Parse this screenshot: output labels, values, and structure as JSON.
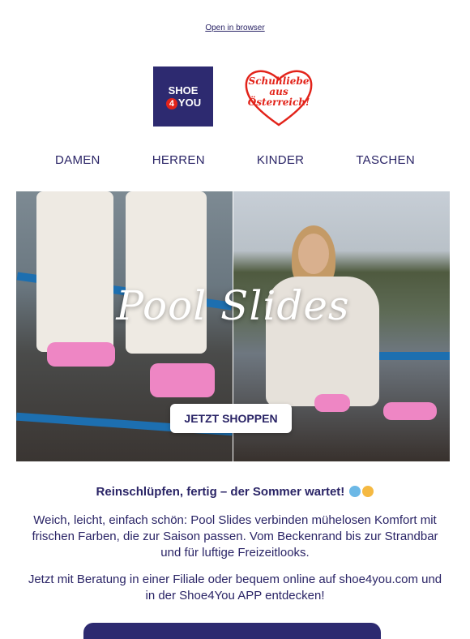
{
  "header": {
    "browser_link": "Open in browser"
  },
  "logo": {
    "line1": "SHOE",
    "four": "4",
    "line2": "YOU"
  },
  "badge": {
    "line1": "Schuhliebe",
    "line2": "aus",
    "line3": "Österreich!"
  },
  "nav": {
    "items": [
      "DAMEN",
      "HERREN",
      "KINDER",
      "TASCHEN"
    ]
  },
  "hero": {
    "headline": "Pool Slides",
    "cta": "JETZT SHOPPEN"
  },
  "content": {
    "tagline": "Reinschlüpfen, fertig – der Sommer wartet!",
    "paragraph1": "Weich, leicht, einfach schön: Pool Slides verbinden mühelosen Komfort mit frischen Farben, die zur Saison passen. Vom Beckenrand bis zur Strandbar und für luftige Freizeitlooks.",
    "paragraph2": "Jetzt mit Beratung in einer Filiale oder bequem online auf shoe4you.com und in der Shoe4You APP entdecken!"
  },
  "colors": {
    "brand": "#2d2a70",
    "accent": "#e2231a",
    "slide": "#ee86c4"
  }
}
